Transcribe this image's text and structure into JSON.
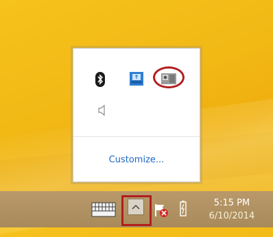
{
  "overflow_panel": {
    "icons": [
      {
        "name": "bluetooth-icon",
        "color": "#1a1a1a"
      },
      {
        "name": "network-icon",
        "color": "#2f7fd2"
      },
      {
        "name": "connection-icon",
        "color": "#7a7a7a"
      },
      {
        "name": "volume-icon",
        "color": "#8a8a8a"
      }
    ],
    "customize_label": "Customize..."
  },
  "taskbar": {
    "time": "5:15 PM",
    "date": "6/10/2014"
  },
  "colors": {
    "highlight": "#b01e1e",
    "link": "#1d66c1",
    "taskbar": "#b09464"
  }
}
